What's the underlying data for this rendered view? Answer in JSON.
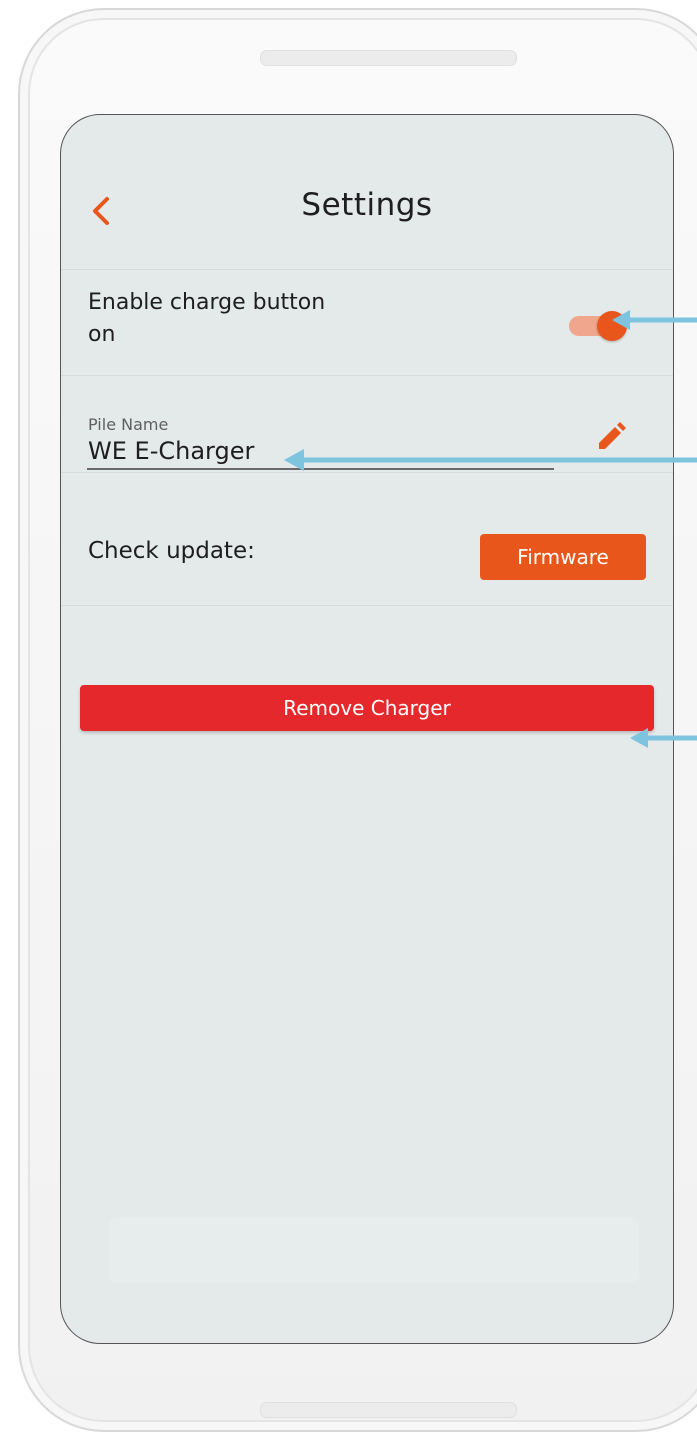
{
  "header": {
    "back_icon": "chevron-left-icon",
    "title": "Settings"
  },
  "charge_button": {
    "label": "Enable charge button on",
    "toggle_on": true
  },
  "pile_name": {
    "label": "Pile Name",
    "value": "WE E-Charger",
    "edit_icon": "pencil-icon"
  },
  "update": {
    "label": "Check update:",
    "button_label": "Firmware"
  },
  "remove": {
    "button_label": "Remove Charger"
  },
  "colors": {
    "accent": "#e8561c",
    "danger": "#e5282b",
    "screen_bg": "#e4e9ea",
    "annotation_arrow": "#7ec4df"
  }
}
